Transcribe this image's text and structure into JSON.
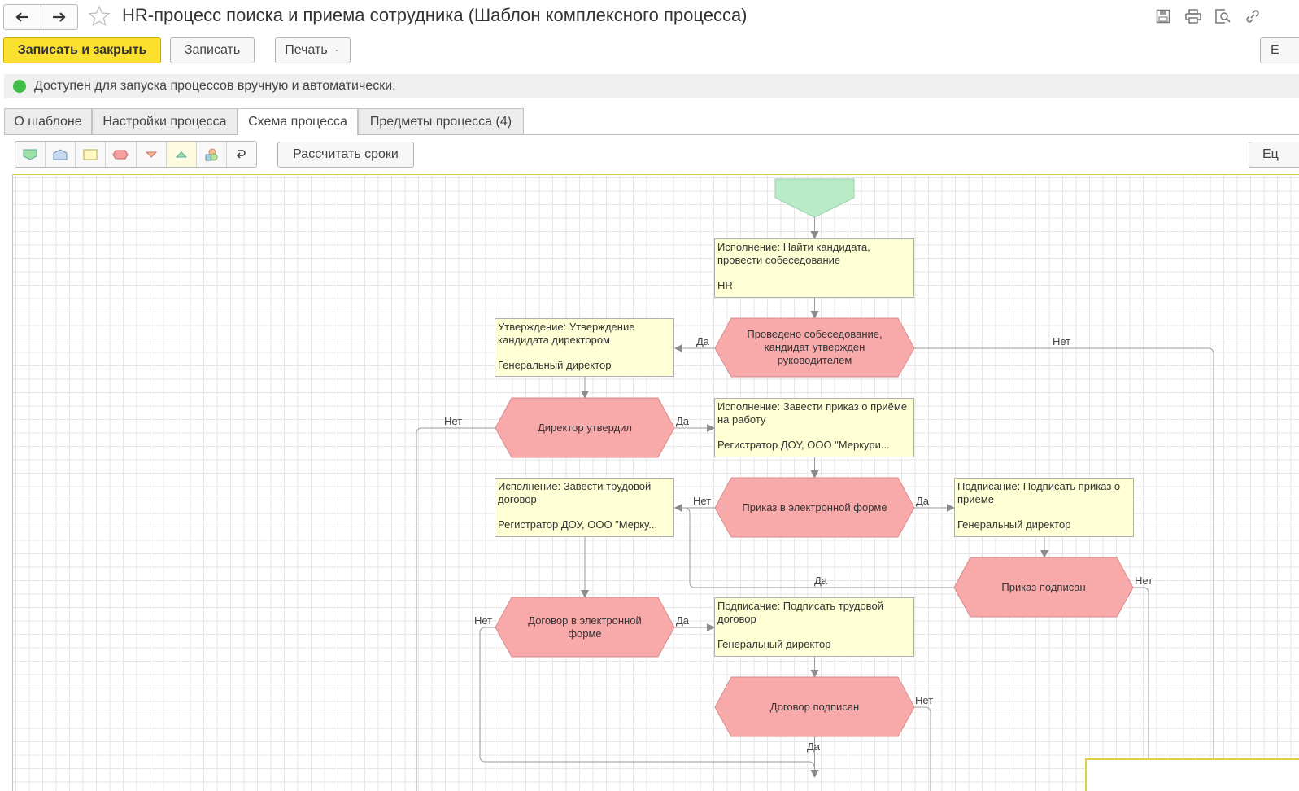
{
  "window": {
    "title": "HR-процесс поиска и приема сотрудника (Шаблон комплексного процесса)",
    "icons": [
      "back-arrow-icon",
      "forward-arrow-icon",
      "star-icon",
      "save-icon",
      "print-icon",
      "preview-icon",
      "link-icon"
    ]
  },
  "commands": {
    "save_close": "Записать и закрыть",
    "save": "Записать",
    "print": "Печать",
    "more_partial": "E"
  },
  "status": {
    "text": "Доступен для запуска процессов вручную и автоматически."
  },
  "tabs": [
    {
      "label": "О шаблоне"
    },
    {
      "label": "Настройки процесса"
    },
    {
      "label": "Схема процесса",
      "active": true
    },
    {
      "label": "Предметы процесса (4)"
    }
  ],
  "scheme_toolbar": {
    "palette": [
      "start-point-icon",
      "end-point-icon",
      "action-icon",
      "condition-icon",
      "split-icon",
      "merge-icon",
      "nested-process-icon",
      "connector-icon"
    ],
    "calc_button": "Рассчитать сроки",
    "right_partial": "Ец"
  },
  "diagram": {
    "tasks": {
      "find_candidate": {
        "title": "Исполнение: Найти кандидата, провести собеседование",
        "performer": "HR"
      },
      "approve_candidate": {
        "title": "Утверждение: Утверждение кандидата директором",
        "performer": "Генеральный директор"
      },
      "create_order": {
        "title": "Исполнение: Завести приказ о приёме на работу",
        "performer": "Регистратор ДОУ, ООО \"Меркури..."
      },
      "create_contract": {
        "title": "Исполнение: Завести трудовой договор",
        "performer": "Регистратор ДОУ, ООО \"Мерку..."
      },
      "sign_order": {
        "title": "Подписание: Подписать приказ о приёме",
        "performer": "Генеральный директор"
      },
      "sign_contract": {
        "title": "Подписание: Подписать трудовой договор",
        "performer": "Генеральный директор"
      }
    },
    "conditions": {
      "interview_done": "Проведено собеседование, кандидат утвержден руководителем",
      "director_approved": "Директор утвердил",
      "order_electronic": "Приказ в электронной форме",
      "order_signed": "Приказ подписан",
      "contract_electronic": "Договор в электронной форме",
      "contract_signed": "Договор подписан"
    },
    "edge_labels": {
      "yes": "Да",
      "no": "Нет"
    }
  }
}
